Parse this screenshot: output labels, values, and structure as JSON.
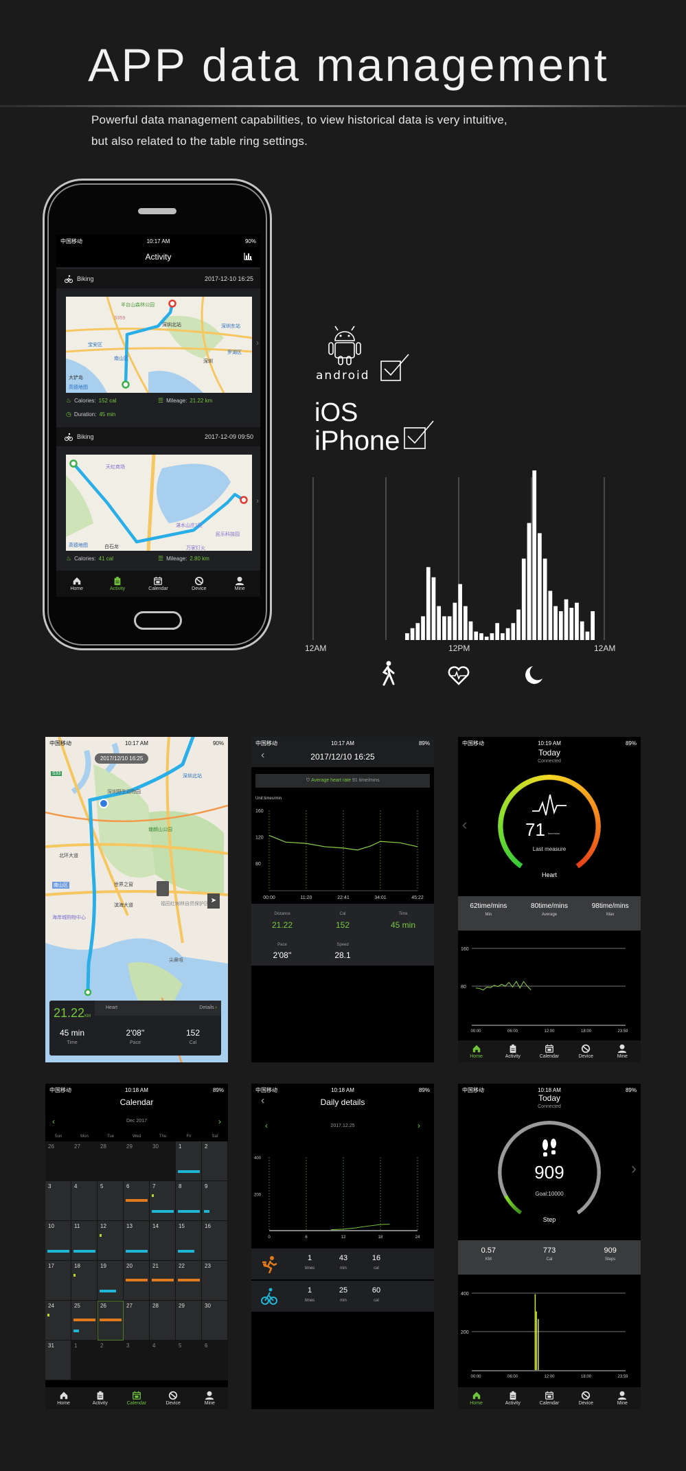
{
  "header": {
    "title": "APP data management",
    "subtitle_line1": "Powerful data management capabilities, to view historical data is very intuitive,",
    "subtitle_line2": "but also related to the table ring settings."
  },
  "colors": {
    "background": "#1b1b1b",
    "accent_green": "#78c93e",
    "route_blue": "#29aee8",
    "cyan": "#1fb6d6",
    "orange": "#e07a1c",
    "yellow_green": "#b8d42a"
  },
  "platforms": {
    "android_label": "android",
    "ios_label": "iOS",
    "iphone_label": "iPhone",
    "android_checked": true,
    "iphone_checked": true
  },
  "chart_data": {
    "type": "bar",
    "x_tick_labels": [
      "12AM",
      "12PM",
      "12AM"
    ],
    "values": [
      4,
      7,
      10,
      14,
      43,
      37,
      20,
      14,
      14,
      22,
      33,
      20,
      11,
      5,
      4,
      2,
      4,
      10,
      4,
      7,
      10,
      18,
      48,
      69,
      100,
      63,
      48,
      29,
      20,
      17,
      24,
      19,
      22,
      11,
      5,
      17
    ],
    "grid": "vertical lines",
    "icons": [
      "walk-icon",
      "heart-rate-icon",
      "moon-icon"
    ]
  },
  "status_bar": {
    "carrier": "中国移动",
    "time_1017": "10:17 AM",
    "time_1018": "10:18 AM",
    "time_1019": "10:19 AM",
    "battery_90": "90%",
    "battery_89": "89%"
  },
  "tabs": [
    "Home",
    "Activity",
    "Calendar",
    "Device",
    "Mine"
  ],
  "phone": {
    "title": "Activity",
    "activities": [
      {
        "type": "Biking",
        "datetime": "2017-12-10 16:25",
        "calories_label": "Calories:",
        "calories": "152 cal",
        "mileage_label": "Mileage:",
        "mileage": "21.22 km",
        "duration_label": "Duration:",
        "duration": "45 min",
        "map_labels": [
          "羊台山森林公园",
          "S359",
          "深圳北站",
          "深圳东站",
          "宝安区",
          "南山区",
          "罗湖区",
          "深圳",
          "大铲岛",
          "高德地图"
        ]
      },
      {
        "type": "Biking",
        "datetime": "2017-12-09 09:50",
        "calories_label": "Calories:",
        "calories": "41 cal",
        "mileage_label": "Mileage:",
        "mileage": "2.80 km",
        "map_labels": [
          "天虹商场",
          "白石龙",
          "湛水山庄1区",
          "民乐科技园",
          "万家灯火",
          "高德地图"
        ]
      }
    ],
    "active_tab": "Activity"
  },
  "map_screen": {
    "date_pill": "2017/12/10 16:25",
    "map_labels": [
      "S33",
      "深圳北站",
      "深圳野生动物园",
      "塘朗山公园",
      "北环大道",
      "世界之窗",
      "南山区",
      "滨海大道",
      "海岸城购物中心",
      "福田红树林自然保护区",
      "尖鼻咀"
    ],
    "distance": "21.22",
    "distance_unit": "KM",
    "heart_tab": "Heart",
    "details": "Details",
    "time": "45 min",
    "time_label": "Time",
    "pace": "2'08''",
    "pace_label": "Pace",
    "cal": "152",
    "cal_label": "Cal"
  },
  "hr_detail": {
    "title": "2017/12/10 16:25",
    "avg_label": "Average heart rate",
    "avg_value": "91 time/mins",
    "unit": "Unit:times/min",
    "y_ticks": [
      "160",
      "120",
      "80"
    ],
    "x_ticks": [
      "00:00",
      "11:20",
      "22:41",
      "34:01",
      "45:22"
    ],
    "series": {
      "x_min": [
        0,
        5,
        11.3,
        17,
        22.7,
        27,
        31,
        34,
        40,
        45.4
      ],
      "bpm": [
        122,
        112,
        110,
        105,
        103,
        100,
        106,
        113,
        111,
        105
      ]
    },
    "ylim": [
      40,
      160
    ],
    "stats": [
      {
        "label": "Distance",
        "value": "21.22"
      },
      {
        "label": "Cal",
        "value": "152"
      },
      {
        "label": "Time",
        "value": "45 min"
      }
    ],
    "stats2": [
      {
        "label": "Pace",
        "value": "2'08''"
      },
      {
        "label": "Speed",
        "value": "28.1"
      }
    ]
  },
  "heart_today": {
    "title": "Today",
    "subtitle": "Connected",
    "value": "71",
    "unit": "time/mins",
    "caption": "Last measure",
    "ring_label": "Heart",
    "summary": [
      {
        "value": "62time/mins",
        "label": "Min"
      },
      {
        "value": "80time/mins",
        "label": "Average"
      },
      {
        "value": "98time/mins",
        "label": "Max"
      }
    ],
    "y_ticks": [
      "160",
      "80"
    ],
    "x_ticks": [
      "00:00",
      "06:00",
      "12:00",
      "18:00",
      "23:59"
    ],
    "ylim": [
      0,
      160
    ],
    "series": {
      "hours": [
        0,
        0.6,
        1.2,
        1.8,
        2.4,
        3,
        3.6,
        4.2,
        4.8,
        5.4,
        6,
        6.6,
        7.2,
        7.8,
        8.4,
        9
      ],
      "bpm": [
        76,
        75,
        72,
        78,
        77,
        82,
        79,
        84,
        80,
        88,
        78,
        90,
        76,
        90,
        80,
        72
      ]
    },
    "active_tab": "Home"
  },
  "calendar": {
    "title": "Calendar",
    "month": "Dec 2017",
    "weekdays": [
      "Sun",
      "Mon",
      "Tue",
      "Wed",
      "Thu",
      "Fri",
      "Sat"
    ],
    "active_tab": "Calendar",
    "selected_day": "26",
    "cells": [
      {
        "d": "26",
        "out": true
      },
      {
        "d": "27",
        "out": true
      },
      {
        "d": "28",
        "out": true
      },
      {
        "d": "29",
        "out": true
      },
      {
        "d": "30",
        "out": true
      },
      {
        "d": "1",
        "marks": [
          {
            "c": "cyan",
            "slot": "bottom",
            "size": "full"
          }
        ]
      },
      {
        "d": "2"
      },
      {
        "d": "3"
      },
      {
        "d": "4"
      },
      {
        "d": "5"
      },
      {
        "d": "6",
        "marks": [
          {
            "c": "orange",
            "slot": "middle",
            "size": "full"
          }
        ]
      },
      {
        "d": "7",
        "marks": [
          {
            "c": "yellow_green",
            "slot": "top",
            "size": "dot"
          },
          {
            "c": "cyan",
            "slot": "bottom",
            "size": "full"
          }
        ]
      },
      {
        "d": "8",
        "marks": [
          {
            "c": "cyan",
            "slot": "bottom",
            "size": "full"
          }
        ]
      },
      {
        "d": "9",
        "marks": [
          {
            "c": "cyan",
            "slot": "bottom",
            "size": "short"
          }
        ]
      },
      {
        "d": "10",
        "marks": [
          {
            "c": "cyan",
            "slot": "bottom",
            "size": "full"
          }
        ]
      },
      {
        "d": "11",
        "marks": [
          {
            "c": "cyan",
            "slot": "bottom",
            "size": "full"
          }
        ]
      },
      {
        "d": "12",
        "marks": [
          {
            "c": "yellow_green",
            "slot": "top",
            "size": "dot"
          }
        ]
      },
      {
        "d": "13",
        "marks": [
          {
            "c": "cyan",
            "slot": "bottom",
            "size": "full"
          }
        ]
      },
      {
        "d": "14"
      },
      {
        "d": "15",
        "marks": [
          {
            "c": "cyan",
            "slot": "bottom",
            "size": "medium"
          }
        ]
      },
      {
        "d": "16"
      },
      {
        "d": "17"
      },
      {
        "d": "18",
        "marks": [
          {
            "c": "yellow_green",
            "slot": "top",
            "size": "dot"
          }
        ]
      },
      {
        "d": "19",
        "marks": [
          {
            "c": "cyan",
            "slot": "bottom",
            "size": "medium"
          }
        ]
      },
      {
        "d": "20",
        "marks": [
          {
            "c": "orange",
            "slot": "middle",
            "size": "full"
          }
        ]
      },
      {
        "d": "21",
        "marks": [
          {
            "c": "orange",
            "slot": "middle",
            "size": "full"
          }
        ]
      },
      {
        "d": "22",
        "marks": [
          {
            "c": "orange",
            "slot": "middle",
            "size": "full"
          }
        ]
      },
      {
        "d": "23"
      },
      {
        "d": "24",
        "marks": [
          {
            "c": "yellow_green",
            "slot": "top",
            "size": "dot"
          }
        ]
      },
      {
        "d": "25",
        "marks": [
          {
            "c": "orange",
            "slot": "middle",
            "size": "full"
          },
          {
            "c": "cyan",
            "slot": "bottom",
            "size": "short"
          }
        ]
      },
      {
        "d": "26",
        "marks": [
          {
            "c": "orange",
            "slot": "middle",
            "size": "full"
          }
        ]
      },
      {
        "d": "27"
      },
      {
        "d": "28"
      },
      {
        "d": "29"
      },
      {
        "d": "30"
      },
      {
        "d": "31"
      },
      {
        "d": "1",
        "out": true
      },
      {
        "d": "2",
        "out": true
      },
      {
        "d": "3",
        "out": true
      },
      {
        "d": "4",
        "out": true
      },
      {
        "d": "5",
        "out": true
      },
      {
        "d": "6",
        "out": true
      }
    ]
  },
  "daily": {
    "title": "Daily details",
    "date": "2017.12.25",
    "y_ticks": [
      "400",
      "200"
    ],
    "x_ticks": [
      "0",
      "6",
      "12",
      "18",
      "24"
    ],
    "ylim": [
      0,
      400
    ],
    "series": {
      "hours": [
        10,
        12,
        14,
        16,
        18,
        19.5
      ],
      "values": [
        5,
        8,
        15,
        25,
        33,
        35
      ]
    },
    "rows": [
      {
        "icon": "running-icon",
        "color": "#e07a1c",
        "times": "1",
        "times_unit": "times",
        "min": "43",
        "min_unit": "min",
        "cal": "16",
        "cal_unit": "cal"
      },
      {
        "icon": "biking-icon",
        "color": "#1fb6d6",
        "times": "1",
        "times_unit": "times",
        "min": "25",
        "min_unit": "min",
        "cal": "60",
        "cal_unit": "cal"
      }
    ]
  },
  "steps_today": {
    "title": "Today",
    "subtitle": "Connected",
    "steps": "909",
    "goal": "Goal:10000",
    "progress": 0.0909,
    "ring_label": "Step",
    "summary": [
      {
        "value": "0.57",
        "label": "KM"
      },
      {
        "value": "773",
        "label": "Cal"
      },
      {
        "value": "909",
        "label": "Steps"
      }
    ],
    "y_ticks": [
      "400",
      "200"
    ],
    "x_ticks": [
      "00:00",
      "06:00",
      "12:00",
      "18:00",
      "23:59"
    ],
    "ylim": [
      0,
      400
    ],
    "bars": {
      "hours": [
        9.6,
        9.8,
        10.1
      ],
      "values": [
        395,
        305,
        265
      ]
    },
    "active_tab": "Home"
  }
}
